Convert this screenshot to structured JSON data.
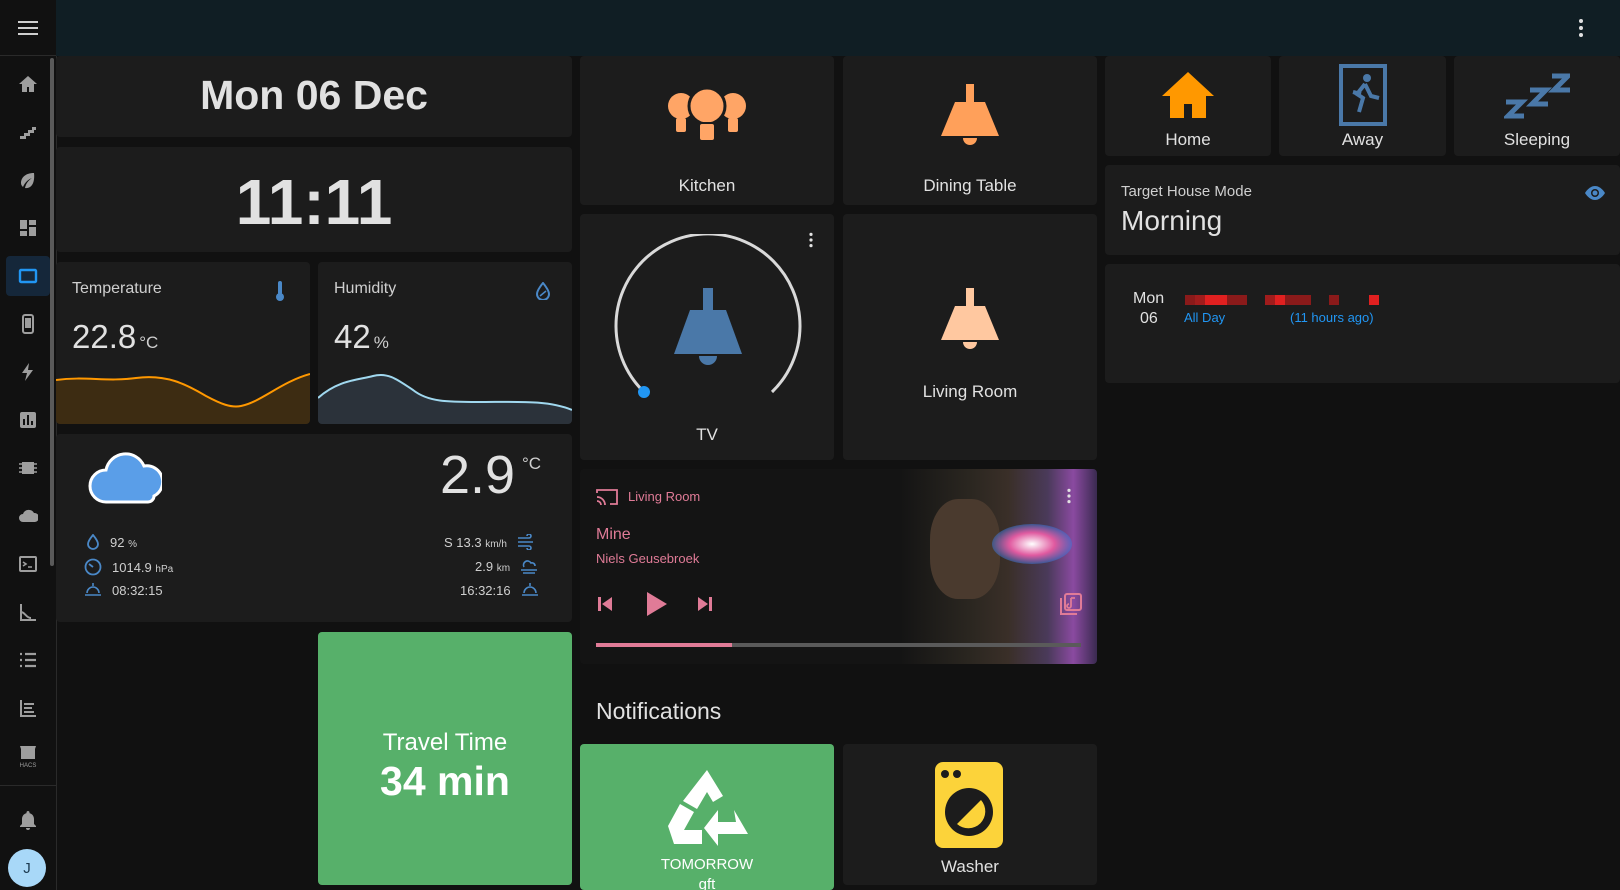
{
  "sidebar": {
    "items": [
      {
        "icon": "home-icon",
        "active": false
      },
      {
        "icon": "stairs-icon",
        "active": false
      },
      {
        "icon": "leaf-icon",
        "active": false
      },
      {
        "icon": "dashboard-icon",
        "active": false
      },
      {
        "icon": "tablet-icon",
        "active": true
      },
      {
        "icon": "phone-icon",
        "active": false
      },
      {
        "icon": "lightning-icon",
        "active": false
      },
      {
        "icon": "chart-box-icon",
        "active": false
      },
      {
        "icon": "chip-icon",
        "active": false
      },
      {
        "icon": "cloud-icon",
        "active": false
      },
      {
        "icon": "terminal-icon",
        "active": false
      },
      {
        "icon": "slide-icon",
        "active": false
      },
      {
        "icon": "list-icon",
        "active": false
      },
      {
        "icon": "history-icon",
        "active": false
      },
      {
        "icon": "hacs-store-icon",
        "active": false
      }
    ],
    "hacs_label": "HACS",
    "avatar_initial": "J"
  },
  "date_card": {
    "text": "Mon 06 Dec"
  },
  "clock_card": {
    "text": "11:11"
  },
  "temperature": {
    "title": "Temperature",
    "value": "22.8",
    "unit": "°C",
    "color": "#ff9800"
  },
  "humidity": {
    "title": "Humidity",
    "value": "42",
    "unit": "%",
    "color": "#a0d8ef"
  },
  "weather": {
    "temperature": "2.9",
    "unit": "°C",
    "humidity": "92",
    "humidity_unit": "%",
    "pressure": "1014.9",
    "pressure_unit": "hPa",
    "sunrise": "08:32:15",
    "wind": "S 13.3",
    "wind_unit": "km/h",
    "visibility": "2.9",
    "visibility_unit": "km",
    "sunset": "16:32:16"
  },
  "travel": {
    "title": "Travel Time",
    "value": "34 min",
    "color": "#57b06a"
  },
  "lights": {
    "kitchen": "Kitchen",
    "dining": "Dining Table",
    "tv": "TV",
    "living": "Living Room"
  },
  "media": {
    "source": "Living Room",
    "title": "Mine",
    "artist": "Niels Geusebroek",
    "progress": 0.28,
    "accent": "#e07b97"
  },
  "notifications": {
    "heading": "Notifications",
    "recycle_label": "TOMORROW",
    "recycle_sub": "gft",
    "washer_label": "Washer"
  },
  "modes": {
    "home": "Home",
    "away": "Away",
    "sleeping": "Sleeping"
  },
  "target_mode": {
    "label": "Target House Mode",
    "value": "Morning"
  },
  "calendar": {
    "day": "Mon",
    "date": "06",
    "allday": "All Day",
    "ago": "(11 hours ago)"
  }
}
